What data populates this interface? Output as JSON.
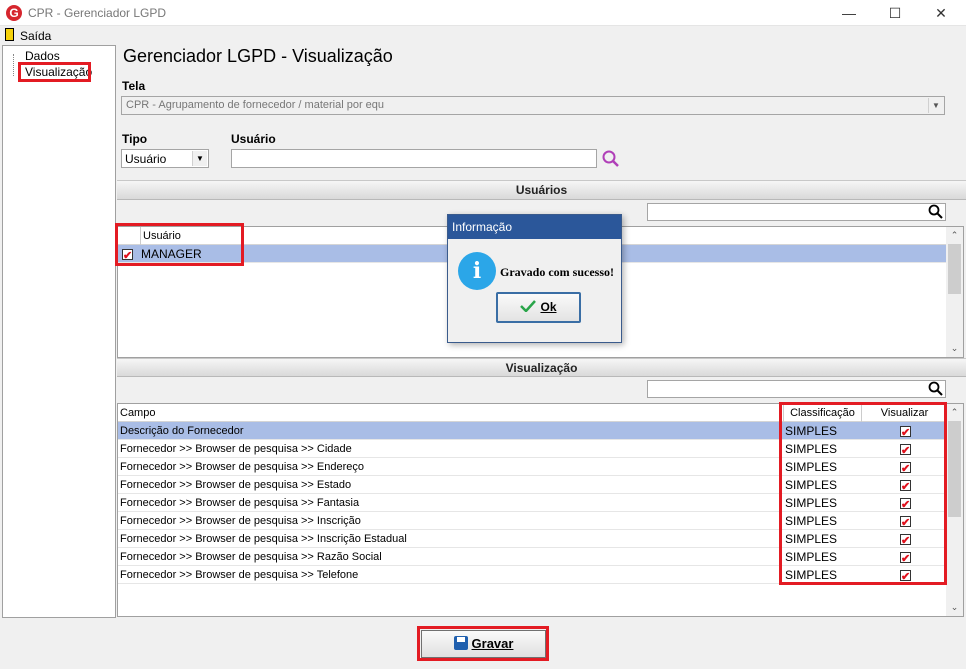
{
  "window": {
    "title": "CPR - Gerenciador LGPD",
    "app_letter": "G",
    "minimize": "—",
    "maximize": "☐",
    "close": "✕"
  },
  "menu": {
    "exit": "Saída"
  },
  "tree": {
    "items": [
      "Dados",
      "Visualização"
    ]
  },
  "page_title": "Gerenciador LGPD - Visualização",
  "tela": {
    "label": "Tela",
    "value": "CPR - Agrupamento de fornecedor / material por equ"
  },
  "tipo": {
    "label": "Tipo",
    "value": "Usuário"
  },
  "usuario": {
    "label": "Usuário",
    "value": ""
  },
  "usuarios_section": {
    "title": "Usuários",
    "column": "Usuário",
    "rows": [
      {
        "checked": true,
        "name": "MANAGER"
      }
    ]
  },
  "visualizacao_section": {
    "title": "Visualização",
    "columns": {
      "campo": "Campo",
      "classificacao": "Classificação",
      "visualizar": "Visualizar"
    },
    "rows": [
      {
        "campo": "Descrição do Fornecedor",
        "classificacao": "SIMPLES",
        "visualizar": true
      },
      {
        "campo": "Fornecedor >> Browser de pesquisa >> Cidade",
        "classificacao": "SIMPLES",
        "visualizar": true
      },
      {
        "campo": "Fornecedor >> Browser de pesquisa >> Endereço",
        "classificacao": "SIMPLES",
        "visualizar": true
      },
      {
        "campo": "Fornecedor >> Browser de pesquisa >> Estado",
        "classificacao": "SIMPLES",
        "visualizar": true
      },
      {
        "campo": "Fornecedor >> Browser de pesquisa >> Fantasia",
        "classificacao": "SIMPLES",
        "visualizar": true
      },
      {
        "campo": "Fornecedor >> Browser de pesquisa >> Inscrição",
        "classificacao": "SIMPLES",
        "visualizar": true
      },
      {
        "campo": "Fornecedor >> Browser de pesquisa >> Inscrição Estadual",
        "classificacao": "SIMPLES",
        "visualizar": true
      },
      {
        "campo": "Fornecedor >> Browser de pesquisa >> Razão Social",
        "classificacao": "SIMPLES",
        "visualizar": true
      },
      {
        "campo": "Fornecedor >> Browser de pesquisa >> Telefone",
        "classificacao": "SIMPLES",
        "visualizar": true
      }
    ]
  },
  "dialog": {
    "title": "Informação",
    "icon": "i",
    "message": "Gravado com sucesso!",
    "ok_label": "Ok"
  },
  "save_button": {
    "label": "Gravar"
  },
  "colors": {
    "highlight": "#a9bde6",
    "annotation": "#e31b23",
    "dialog_title": "#2b579a"
  }
}
